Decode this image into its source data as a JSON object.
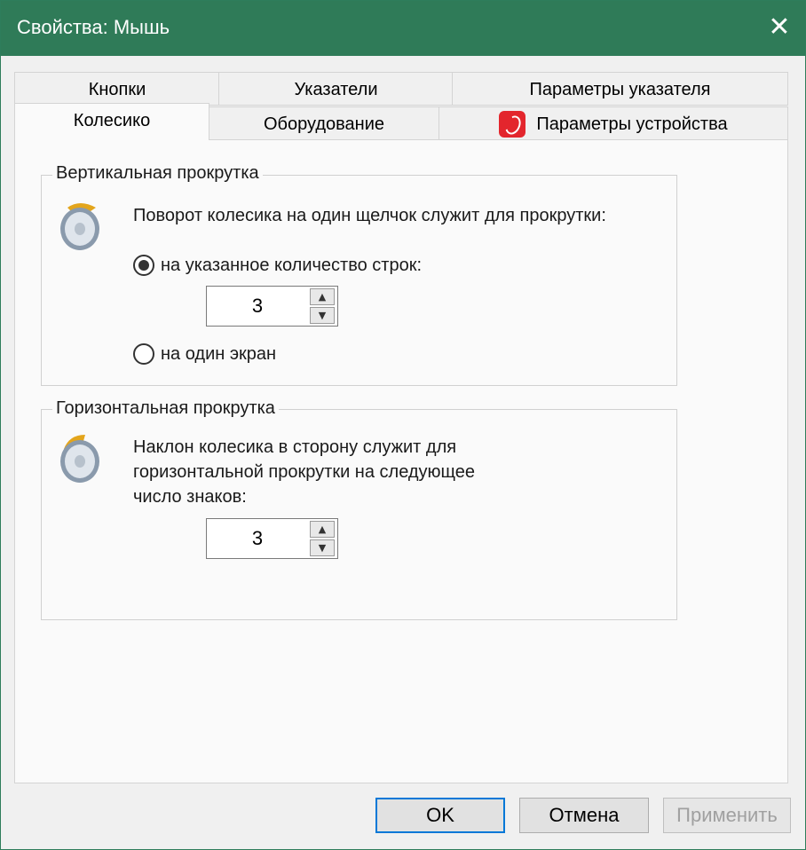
{
  "window": {
    "title": "Свойства: Мышь",
    "close_glyph": "✕"
  },
  "tabs": {
    "row1": [
      "Кнопки",
      "Указатели",
      "Параметры указателя"
    ],
    "row2": [
      "Колесико",
      "Оборудование",
      "Параметры устройства"
    ],
    "active": "Колесико",
    "device_icon": "device-settings-icon"
  },
  "vertical": {
    "title": "Вертикальная прокрутка",
    "description": "Поворот колесика на один щелчок служит для прокрутки:",
    "option_lines": "на указанное количество строк:",
    "option_screen": "на один экран",
    "selected": "option_lines",
    "lines_value": "3"
  },
  "horizontal": {
    "title": "Горизонтальная прокрутка",
    "description_line1": "Наклон колесика в сторону служит для",
    "description_line2": "горизонтальной прокрутки на следующее",
    "description_line3": "число знаков:",
    "chars_value": "3"
  },
  "spin": {
    "up": "▲",
    "down": "▼"
  },
  "buttons": {
    "ok": "OK",
    "cancel": "Отмена",
    "apply": "Применить"
  },
  "colors": {
    "titlebar": "#2f7b58",
    "default_button_border": "#0078d7",
    "device_icon": "#e3262d"
  }
}
